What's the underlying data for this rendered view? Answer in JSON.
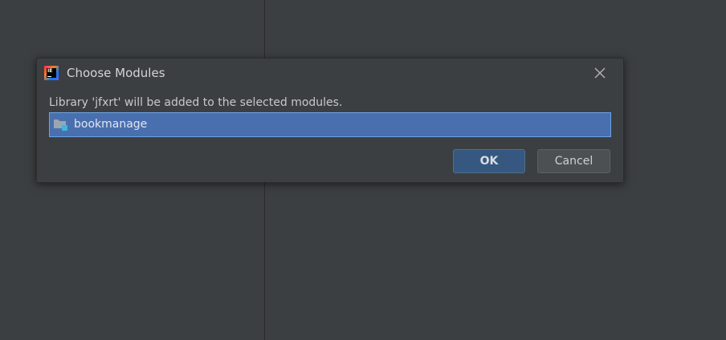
{
  "dialog": {
    "title": "Choose Modules",
    "app_icon": "intellij-idea-icon",
    "close_icon": "close-icon",
    "message": "Library 'jfxrt' will be added to the selected modules.",
    "modules": [
      {
        "name": "bookmanage",
        "icon": "module-folder-icon",
        "selected": true
      }
    ],
    "ok_label": "OK",
    "cancel_label": "Cancel"
  },
  "colors": {
    "background": "#3c3f41",
    "selection": "#4a6fae",
    "selection_border": "#6aa3e6",
    "ok_button": "#365880",
    "cancel_button": "#4c5052"
  }
}
